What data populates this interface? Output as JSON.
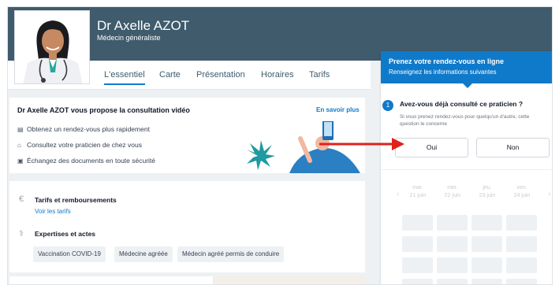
{
  "doctor": {
    "name": "Dr Axelle AZOT",
    "specialty": "Médecin généraliste"
  },
  "tabs": [
    {
      "label": "L'essentiel",
      "active": true
    },
    {
      "label": "Carte",
      "active": false
    },
    {
      "label": "Présentation",
      "active": false
    },
    {
      "label": "Horaires",
      "active": false
    },
    {
      "label": "Tarifs",
      "active": false
    }
  ],
  "video": {
    "title": "Dr Axelle AZOT vous propose la consultation vidéo",
    "more_link": "En savoir plus",
    "features": [
      {
        "icon": "calendar-clock-icon",
        "text": "Obtenez un rendez-vous plus rapidement"
      },
      {
        "icon": "home-icon",
        "text": "Consultez votre praticien de chez vous"
      },
      {
        "icon": "document-icon",
        "text": "Échangez des documents en toute sécurité"
      }
    ]
  },
  "tarifs": {
    "title": "Tarifs et remboursements",
    "link": "Voir les tarifs",
    "icon": "euro-icon"
  },
  "expertises": {
    "title": "Expertises et actes",
    "icon": "stethoscope-icon",
    "tags": [
      "Vaccination COVID-19",
      "Médecine agréée",
      "Médecin agréé permis de conduire"
    ]
  },
  "booking": {
    "title": "Prenez votre rendez-vous en ligne",
    "subtitle": "Renseignez les informations suivantes",
    "step": "1",
    "question": "Avez-vous déjà consulté ce praticien ?",
    "help": "Si vous prenez rendez-vous pour quelqu'un d'autre, cette question le concerne",
    "yes": "Oui",
    "no": "Non",
    "days": [
      {
        "day": "mar.",
        "date": "21 juin"
      },
      {
        "day": "mer.",
        "date": "22 juin"
      },
      {
        "day": "jeu.",
        "date": "23 juin"
      },
      {
        "day": "ven.",
        "date": "24 juin"
      }
    ],
    "prev": "‹",
    "next": "›"
  },
  "colors": {
    "header": "#3f5b6c",
    "accent": "#107aca",
    "arrow": "#e0201d"
  }
}
